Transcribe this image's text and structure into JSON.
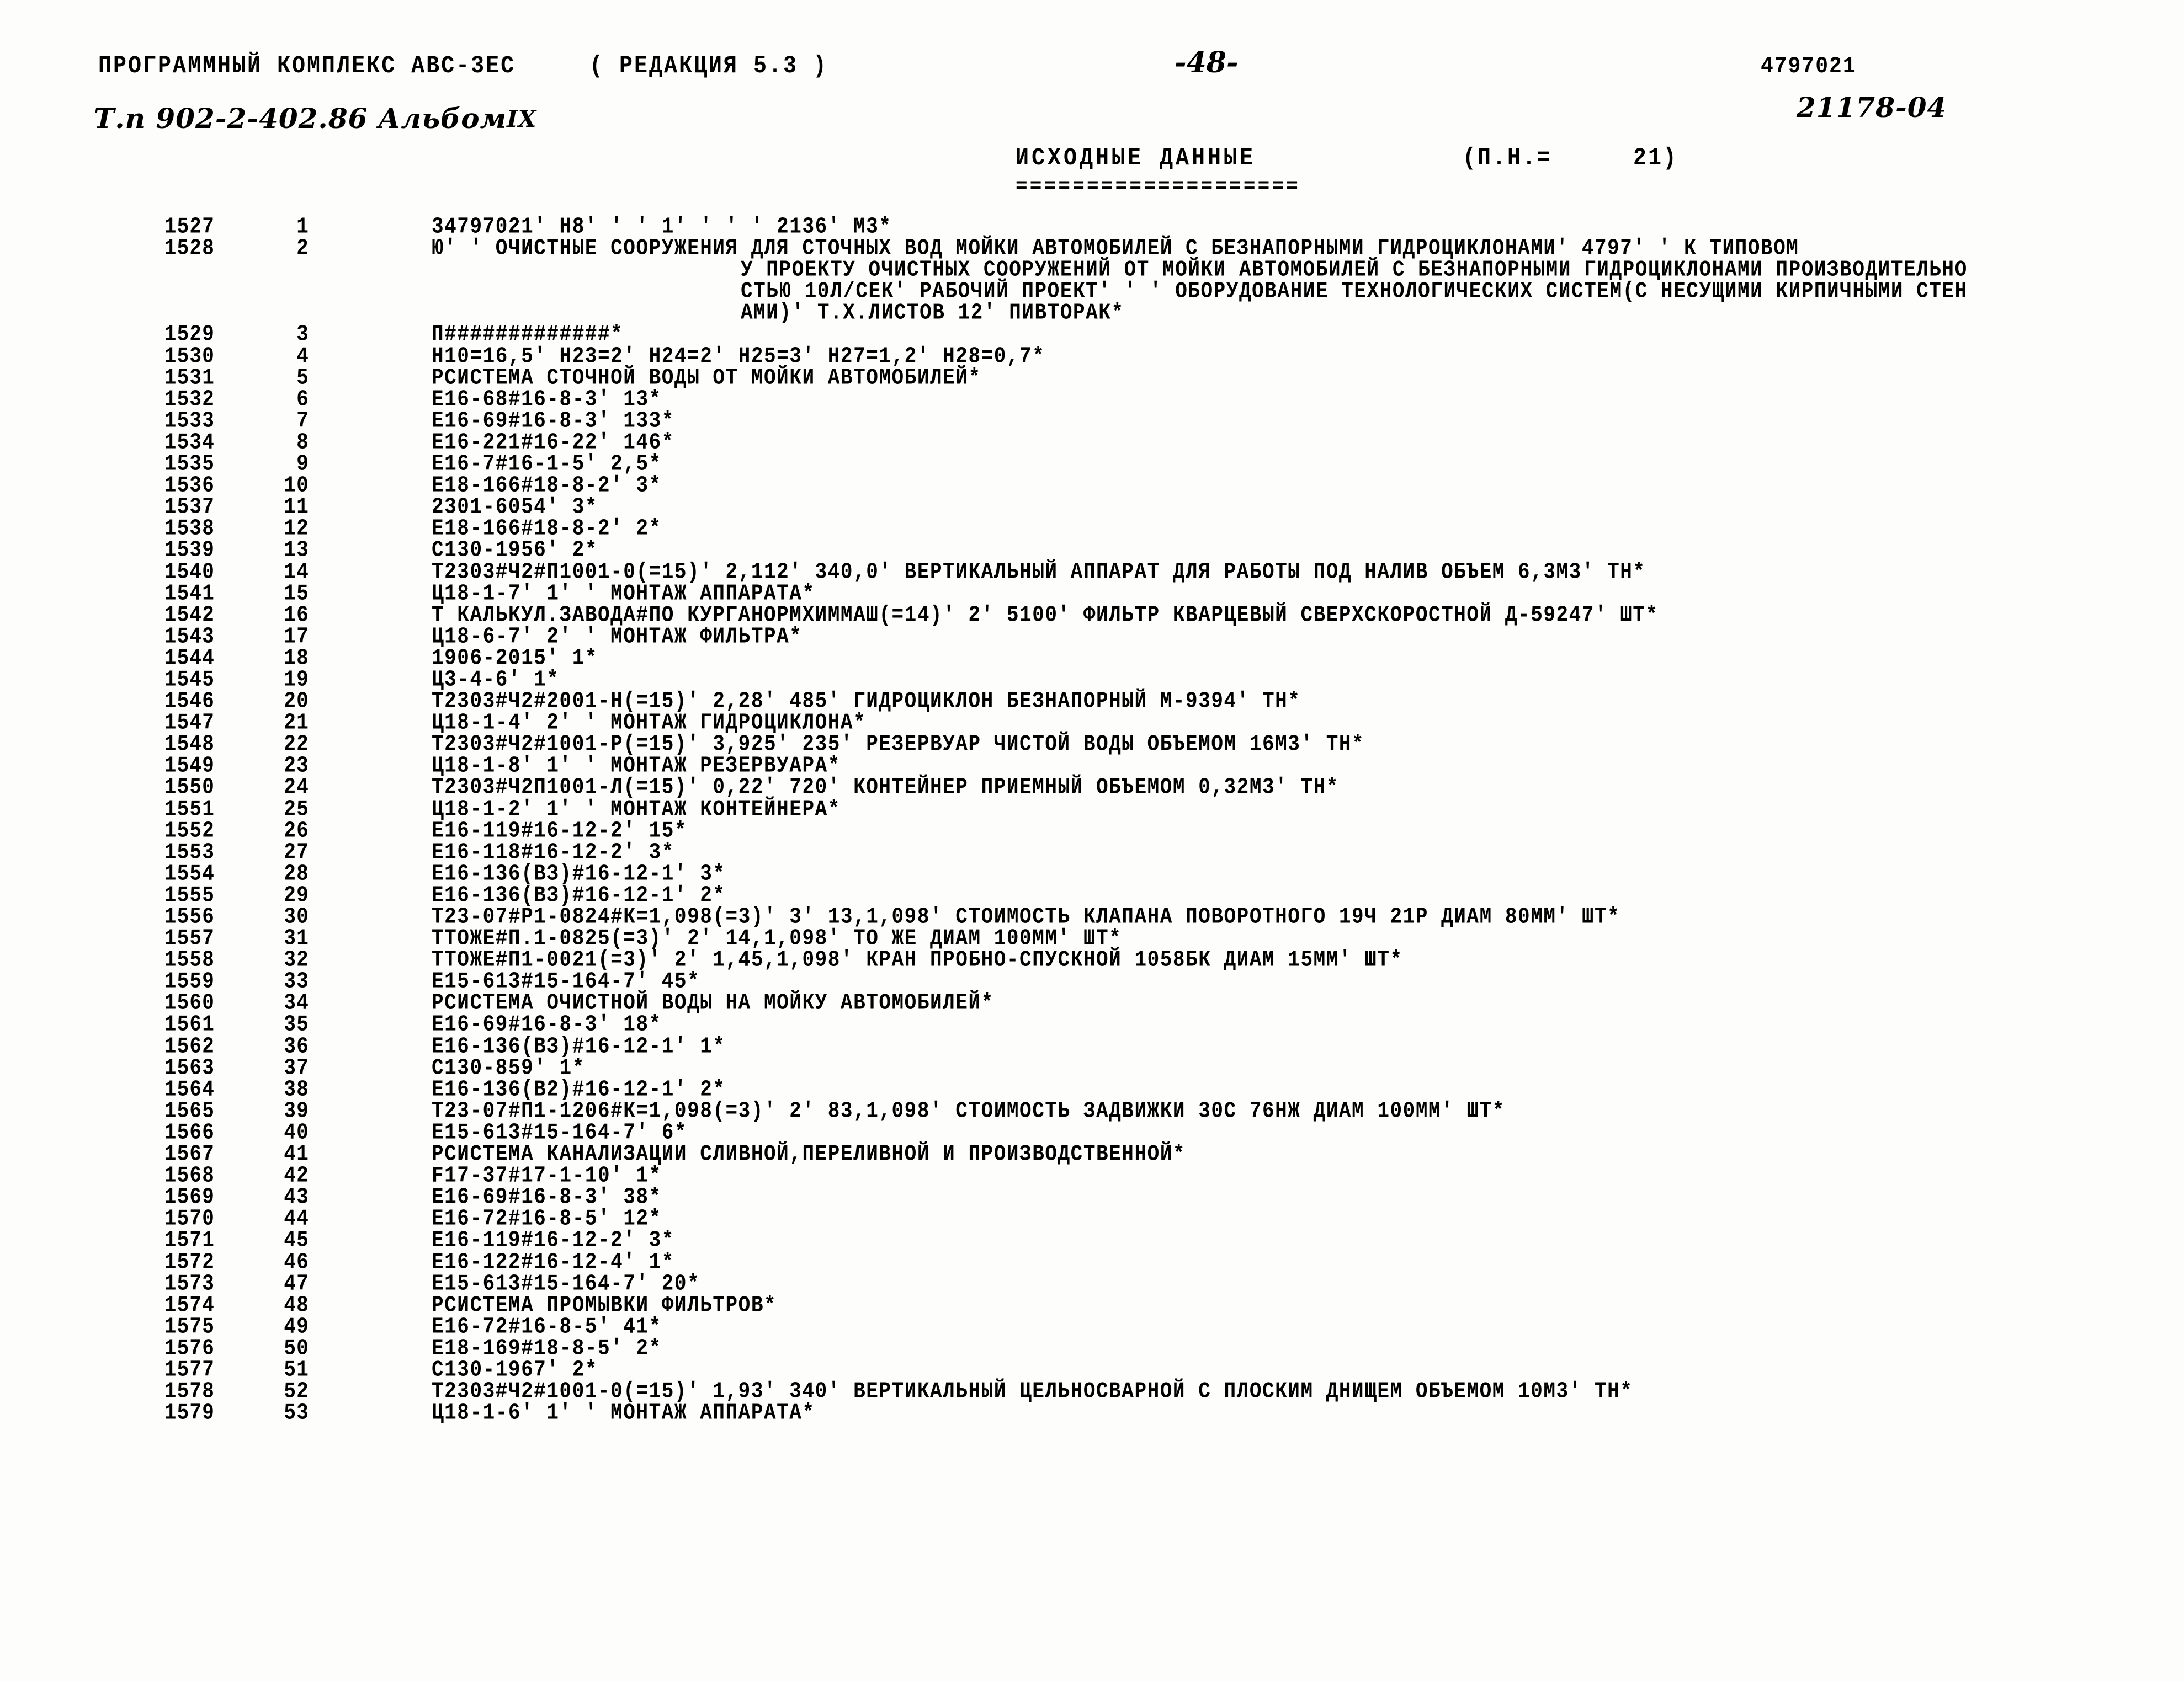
{
  "header": {
    "program_title": "ПРОГРАММНЫЙ КОМПЛЕКС АВС-3ЕС",
    "revision": "( РЕДАКЦИЯ  5.3 )",
    "page_number": "-48-",
    "job_code": "4797021",
    "tp_label": "Т.п 902-2-402.86 Альбом",
    "tp_album_roman": "IX",
    "doc_code": "21178-04"
  },
  "title": {
    "heading": "ИСХОДНЫЕ ДАННЫЕ",
    "underline": "====================",
    "pn_label": "(П.Н.=",
    "pn_value": "21)"
  },
  "columns": {
    "seq": "sequence-number",
    "num": "record-number",
    "text": "record-text"
  },
  "rows": [
    {
      "seq": "1527",
      "num": "1",
      "text": "34797021' H8'  '  ' 1'  '  '  ' 2136' M3*",
      "indent": 0
    },
    {
      "seq": "1528",
      "num": "2",
      "text": "Ю'  ' ОЧИСТНЫЕ СООРУЖЕНИЯ ДЛЯ СТОЧНЫХ ВОД МОЙКИ АВТОМОБИЛЕЙ С БЕЗНАПОРНЫМИ ГИДРОЦИКЛОНАМИ' 4797'  ' К ТИПОВОМ",
      "indent": 0
    },
    {
      "seq": "",
      "num": "",
      "text": "У ПРОЕКТУ ОЧИСТНЫХ СООРУЖЕНИЙ ОТ МОЙКИ АВТОМОБИЛЕЙ С БЕЗНАПОРНЫМИ ГИДРОЦИКЛОНАМИ ПРОИЗВОДИТЕЛЬНО",
      "indent": 1
    },
    {
      "seq": "",
      "num": "",
      "text": "СТЬЮ 10Л/СЕК' РАБОЧИЙ ПРОЕКТ'  '  ' ОБОРУДОВАНИЕ ТЕХНОЛОГИЧЕСКИХ СИСТЕМ(С НЕСУЩИМИ КИРПИЧНЫМИ СТЕН",
      "indent": 1
    },
    {
      "seq": "",
      "num": "",
      "text": "АМИ)' Т.Х.ЛИСТОВ 12' ПИВТОРАК*",
      "indent": 1
    },
    {
      "seq": "1529",
      "num": "3",
      "text": "П#############*",
      "indent": 0
    },
    {
      "seq": "1530",
      "num": "4",
      "text": "H10=16,5' H23=2' H24=2' H25=3' H27=1,2' H28=0,7*",
      "indent": 0
    },
    {
      "seq": "1531",
      "num": "5",
      "text": "РСИСТЕМА СТОЧНОЙ ВОДЫ ОТ МОЙКИ АВТОМОБИЛЕЙ*",
      "indent": 0
    },
    {
      "seq": "1532",
      "num": "6",
      "text": "Е16-68#16-8-3' 13*",
      "indent": 0
    },
    {
      "seq": "1533",
      "num": "7",
      "text": "Е16-69#16-8-3' 133*",
      "indent": 0
    },
    {
      "seq": "1534",
      "num": "8",
      "text": "Е16-221#16-22' 146*",
      "indent": 0
    },
    {
      "seq": "1535",
      "num": "9",
      "text": "Е16-7#16-1-5' 2,5*",
      "indent": 0
    },
    {
      "seq": "1536",
      "num": "10",
      "text": "Е18-166#18-8-2' 3*",
      "indent": 0
    },
    {
      "seq": "1537",
      "num": "11",
      "text": "2301-6054' 3*",
      "indent": 0
    },
    {
      "seq": "1538",
      "num": "12",
      "text": "Е18-166#18-8-2' 2*",
      "indent": 0
    },
    {
      "seq": "1539",
      "num": "13",
      "text": "С130-1956' 2*",
      "indent": 0
    },
    {
      "seq": "1540",
      "num": "14",
      "text": "Т2303#Ч2#П1001-0(=15)' 2,112' 340,0' ВЕРТИКАЛЬНЫЙ АППАРАТ ДЛЯ РАБОТЫ ПОД НАЛИВ ОБЪЕМ 6,3М3' ТН*",
      "indent": 0
    },
    {
      "seq": "1541",
      "num": "15",
      "text": "Ц18-1-7' 1'  ' МОНТАЖ АППАРАТА*",
      "indent": 0
    },
    {
      "seq": "1542",
      "num": "16",
      "text": "Т КАЛЬКУЛ.ЗАВОДА#ПО КУРГАНОРМХИММАШ(=14)' 2' 5100' ФИЛЬТР КВАРЦЕВЫЙ СВЕРХСКОРОСТНОЙ Д-59247' ШТ*",
      "indent": 0
    },
    {
      "seq": "1543",
      "num": "17",
      "text": "Ц18-6-7' 2'  ' МОНТАЖ ФИЛЬТРА*",
      "indent": 0
    },
    {
      "seq": "1544",
      "num": "18",
      "text": "1906-2015' 1*",
      "indent": 0
    },
    {
      "seq": "1545",
      "num": "19",
      "text": "Ц3-4-6' 1*",
      "indent": 0
    },
    {
      "seq": "1546",
      "num": "20",
      "text": "Т2303#Ч2#2001-Н(=15)' 2,28' 485' ГИДРОЦИКЛОН БЕЗНАПОРНЫЙ М-9394' ТН*",
      "indent": 0
    },
    {
      "seq": "1547",
      "num": "21",
      "text": "Ц18-1-4' 2'  ' МОНТАЖ ГИДРОЦИКЛОНА*",
      "indent": 0
    },
    {
      "seq": "1548",
      "num": "22",
      "text": "Т2303#Ч2#1001-Р(=15)' 3,925' 235' РЕЗЕРВУАР ЧИСТОЙ ВОДЫ ОБЪЕМОМ 16М3' ТН*",
      "indent": 0
    },
    {
      "seq": "1549",
      "num": "23",
      "text": "Ц18-1-8' 1'  ' МОНТАЖ РЕЗЕРВУАРА*",
      "indent": 0
    },
    {
      "seq": "1550",
      "num": "24",
      "text": "Т2303#Ч2П1001-Л(=15)' 0,22' 720' КОНТЕЙНЕР ПРИЕМНЫЙ ОБЪЕМОМ 0,32М3' ТН*",
      "indent": 0
    },
    {
      "seq": "1551",
      "num": "25",
      "text": "Ц18-1-2' 1'  ' МОНТАЖ КОНТЕЙНЕРА*",
      "indent": 0
    },
    {
      "seq": "1552",
      "num": "26",
      "text": "Е16-119#16-12-2' 15*",
      "indent": 0
    },
    {
      "seq": "1553",
      "num": "27",
      "text": "Е16-118#16-12-2' 3*",
      "indent": 0
    },
    {
      "seq": "1554",
      "num": "28",
      "text": "Е16-136(ВЗ)#16-12-1' 3*",
      "indent": 0
    },
    {
      "seq": "1555",
      "num": "29",
      "text": "Е16-136(ВЗ)#16-12-1' 2*",
      "indent": 0
    },
    {
      "seq": "1556",
      "num": "30",
      "text": "Т23-07#Р1-0824#К=1,098(=3)' 3' 13,1,098' СТОИМОСТЬ КЛАПАНА ПОВОРОТНОГО 19Ч 21Р ДИАМ 80ММ' ШТ*",
      "indent": 0
    },
    {
      "seq": "1557",
      "num": "31",
      "text": "ТТОЖЕ#П.1-0825(=3)' 2' 14,1,098' ТО ЖЕ ДИАМ 100ММ' ШТ*",
      "indent": 0
    },
    {
      "seq": "1558",
      "num": "32",
      "text": "ТТОЖЕ#П1-0021(=3)' 2' 1,45,1,098' КРАН ПРОБНО-СПУСКНОЙ 1058БК ДИАМ 15ММ' ШТ*",
      "indent": 0
    },
    {
      "seq": "1559",
      "num": "33",
      "text": "Е15-613#15-164-7' 45*",
      "indent": 0
    },
    {
      "seq": "1560",
      "num": "34",
      "text": "РСИСТЕМА ОЧИСТНОЙ ВОДЫ НА МОЙКУ АВТОМОБИЛЕЙ*",
      "indent": 0
    },
    {
      "seq": "1561",
      "num": "35",
      "text": "Е16-69#16-8-3' 18*",
      "indent": 0
    },
    {
      "seq": "1562",
      "num": "36",
      "text": "Е16-136(ВЗ)#16-12-1' 1*",
      "indent": 0
    },
    {
      "seq": "1563",
      "num": "37",
      "text": "С130-859' 1*",
      "indent": 0
    },
    {
      "seq": "1564",
      "num": "38",
      "text": "Е16-136(В2)#16-12-1' 2*",
      "indent": 0
    },
    {
      "seq": "1565",
      "num": "39",
      "text": "Т23-07#П1-1206#К=1,098(=3)' 2' 83,1,098' СТОИМОСТЬ ЗАДВИЖКИ 30С 76НЖ ДИАМ 100ММ' ШТ*",
      "indent": 0
    },
    {
      "seq": "1566",
      "num": "40",
      "text": "Е15-613#15-164-7' 6*",
      "indent": 0
    },
    {
      "seq": "1567",
      "num": "41",
      "text": "РСИСТЕМА КАНАЛИЗАЦИИ СЛИВНОЙ,ПЕРЕЛИВНОЙ И ПРОИЗВОДСТВЕННОЙ*",
      "indent": 0
    },
    {
      "seq": "1568",
      "num": "42",
      "text": "F17-37#17-1-10' 1*",
      "indent": 0
    },
    {
      "seq": "1569",
      "num": "43",
      "text": "Е16-69#16-8-3' 38*",
      "indent": 0
    },
    {
      "seq": "1570",
      "num": "44",
      "text": "Е16-72#16-8-5' 12*",
      "indent": 0
    },
    {
      "seq": "1571",
      "num": "45",
      "text": "Е16-119#16-12-2' 3*",
      "indent": 0
    },
    {
      "seq": "1572",
      "num": "46",
      "text": "Е16-122#16-12-4' 1*",
      "indent": 0
    },
    {
      "seq": "1573",
      "num": "47",
      "text": "Е15-613#15-164-7' 20*",
      "indent": 0
    },
    {
      "seq": "1574",
      "num": "48",
      "text": "РСИСТЕМА ПРОМЫВКИ ФИЛЬТРОВ*",
      "indent": 0
    },
    {
      "seq": "1575",
      "num": "49",
      "text": "Е16-72#16-8-5' 41*",
      "indent": 0
    },
    {
      "seq": "1576",
      "num": "50",
      "text": "Е18-169#18-8-5' 2*",
      "indent": 0
    },
    {
      "seq": "1577",
      "num": "51",
      "text": "С130-1967' 2*",
      "indent": 0
    },
    {
      "seq": "1578",
      "num": "52",
      "text": "Т2303#Ч2#1001-0(=15)' 1,93' 340' ВЕРТИКАЛЬНЫЙ ЦЕЛЬНОСВАРНОЙ С ПЛОСКИМ ДНИЩЕМ ОБЪЕМОМ 10М3' ТН*",
      "indent": 0
    },
    {
      "seq": "1579",
      "num": "53",
      "text": "Ц18-1-6' 1'  ' МОНТАЖ АППАРАТА*",
      "indent": 0
    }
  ]
}
